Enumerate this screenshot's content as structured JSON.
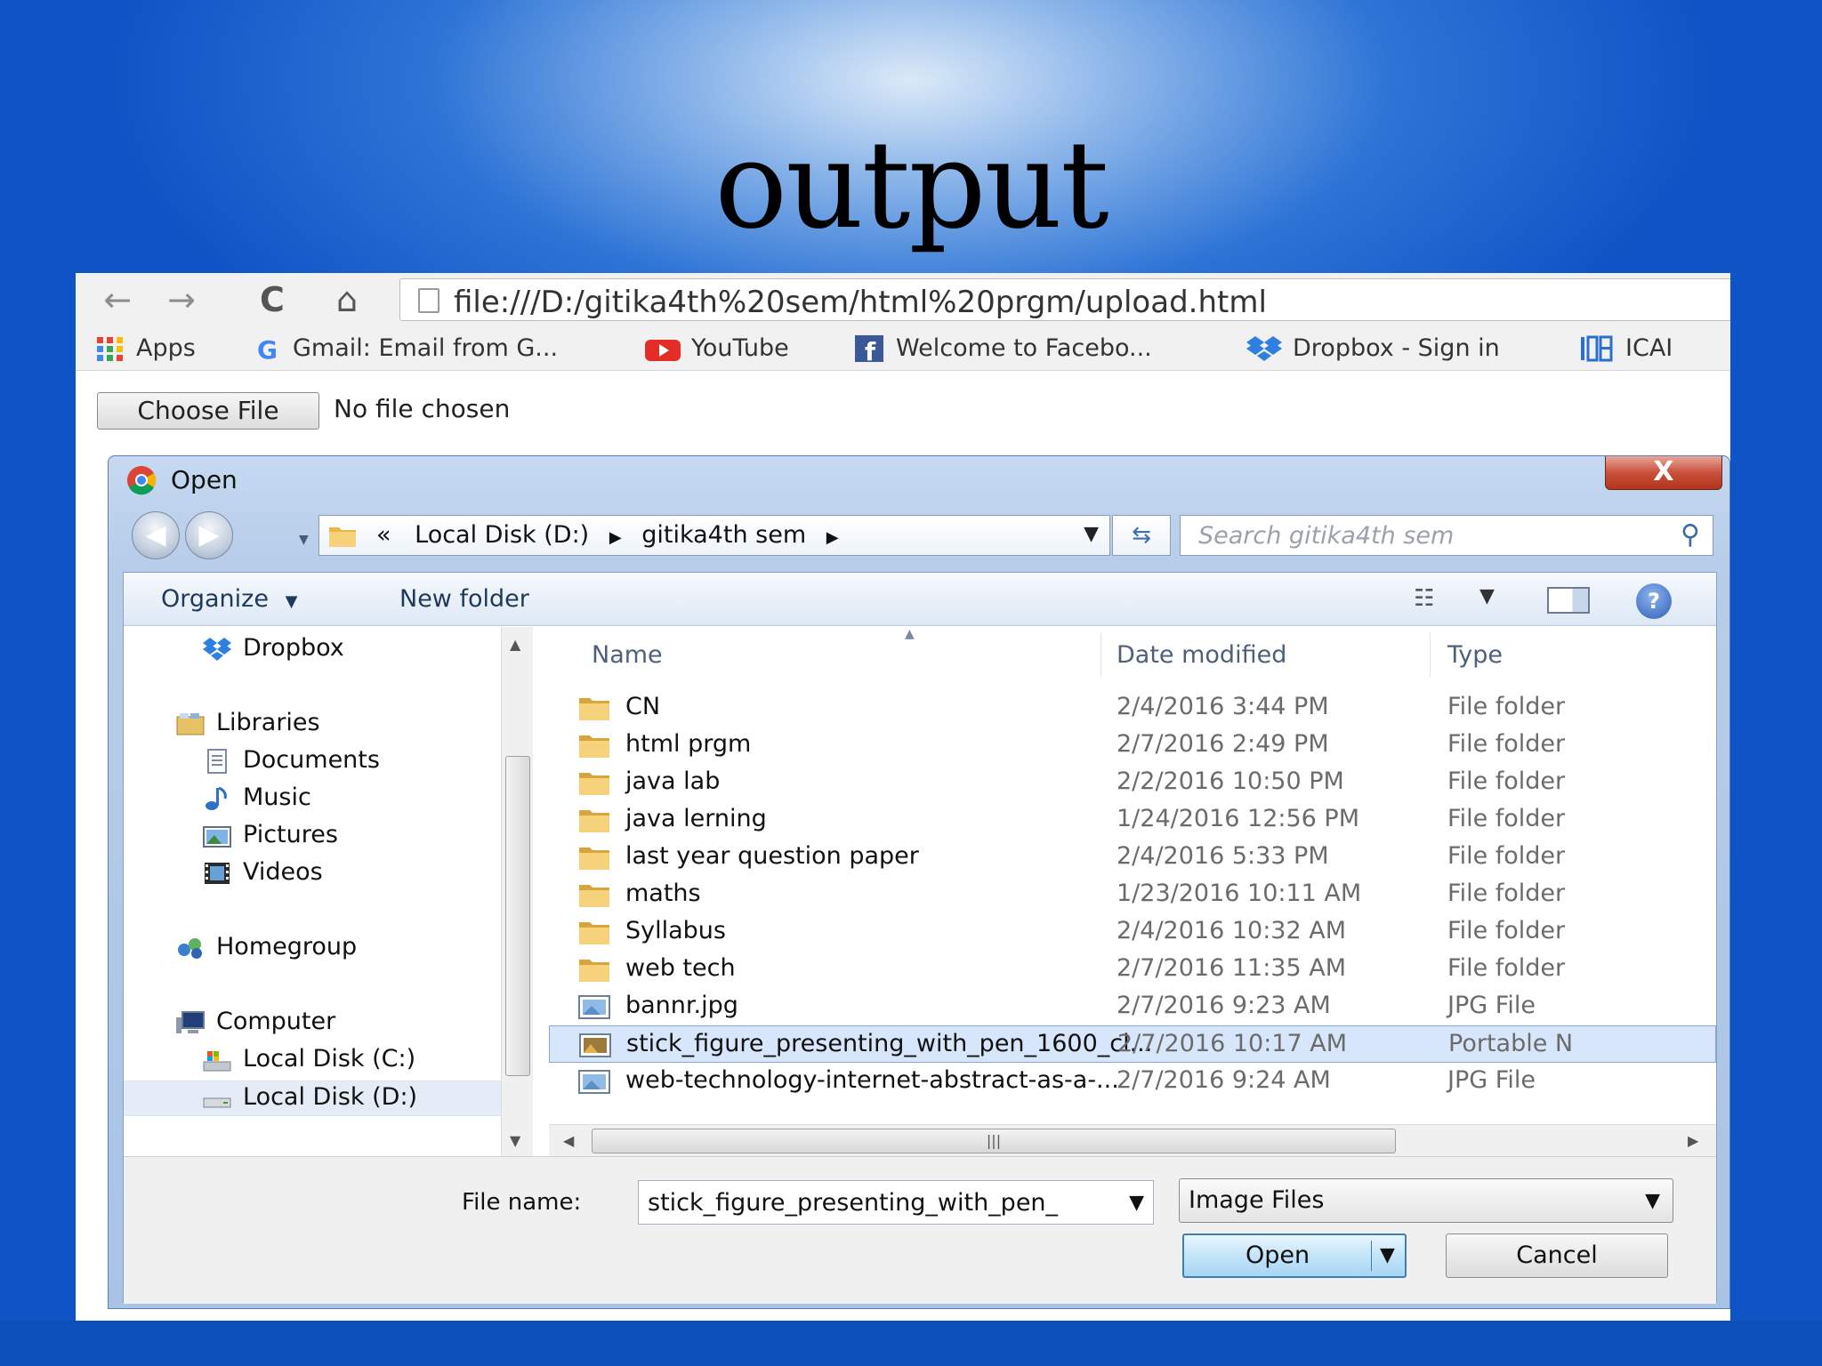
{
  "slide": {
    "title": "output"
  },
  "browser": {
    "nav": {
      "back": "←",
      "forward": "→",
      "reload": "C",
      "home": "⌂"
    },
    "url": "file:///D:/gitika4th%20sem/html%20prgm/upload.html",
    "bookmarks": [
      {
        "label": "Apps",
        "icon": "apps-grid-icon"
      },
      {
        "label": "Gmail: Email from G...",
        "icon": "google-icon"
      },
      {
        "label": "YouTube",
        "icon": "youtube-icon"
      },
      {
        "label": "Welcome to Facebo...",
        "icon": "facebook-icon"
      },
      {
        "label": "Dropbox - Sign in",
        "icon": "dropbox-icon"
      },
      {
        "label": "ICAI",
        "icon": "icai-icon"
      }
    ]
  },
  "page": {
    "choose_file_label": "Choose File",
    "no_file_text": "No file chosen"
  },
  "dialog": {
    "title": "Open",
    "close_label": "X",
    "address": {
      "prefix": "«",
      "crumbs": [
        "Local Disk (D:)",
        "gitika4th sem"
      ]
    },
    "search_placeholder": "Search gitika4th sem",
    "toolbar": {
      "organize": "Organize",
      "new_folder": "New folder"
    },
    "nav_pane": [
      {
        "label": "Dropbox",
        "icon": "dropbox-icon",
        "level": 1
      },
      {
        "label": "Libraries",
        "icon": "libraries-icon",
        "level": 0
      },
      {
        "label": "Documents",
        "icon": "documents-icon",
        "level": 1
      },
      {
        "label": "Music",
        "icon": "music-icon",
        "level": 1
      },
      {
        "label": "Pictures",
        "icon": "pictures-icon",
        "level": 1
      },
      {
        "label": "Videos",
        "icon": "videos-icon",
        "level": 1
      },
      {
        "label": "Homegroup",
        "icon": "homegroup-icon",
        "level": 0
      },
      {
        "label": "Computer",
        "icon": "computer-icon",
        "level": 0
      },
      {
        "label": "Local Disk (C:)",
        "icon": "drive-c-icon",
        "level": 1
      },
      {
        "label": "Local Disk (D:)",
        "icon": "drive-d-icon",
        "level": 1,
        "selected": true
      }
    ],
    "columns": {
      "name": "Name",
      "date": "Date modified",
      "type": "Type"
    },
    "files": [
      {
        "name": "CN",
        "date": "2/4/2016 3:44 PM",
        "type": "File folder",
        "icon": "folder-icon"
      },
      {
        "name": "html prgm",
        "date": "2/7/2016 2:49 PM",
        "type": "File folder",
        "icon": "folder-icon"
      },
      {
        "name": "java lab",
        "date": "2/2/2016 10:50 PM",
        "type": "File folder",
        "icon": "folder-icon"
      },
      {
        "name": "java lerning",
        "date": "1/24/2016 12:56 PM",
        "type": "File folder",
        "icon": "folder-icon"
      },
      {
        "name": "last year question paper",
        "date": "2/4/2016 5:33 PM",
        "type": "File folder",
        "icon": "folder-icon"
      },
      {
        "name": "maths",
        "date": "1/23/2016 10:11 AM",
        "type": "File folder",
        "icon": "folder-icon"
      },
      {
        "name": "Syllabus",
        "date": "2/4/2016 10:32 AM",
        "type": "File folder",
        "icon": "folder-icon"
      },
      {
        "name": "web tech",
        "date": "2/7/2016 11:35 AM",
        "type": "File folder",
        "icon": "folder-icon"
      },
      {
        "name": "bannr.jpg",
        "date": "2/7/2016 9:23 AM",
        "type": "JPG File",
        "icon": "image-file-icon"
      },
      {
        "name": "stick_figure_presenting_with_pen_1600_cl...",
        "date": "2/7/2016 10:17 AM",
        "type": "Portable N",
        "icon": "png-file-icon",
        "selected": true
      },
      {
        "name": "web-technology-internet-abstract-as-a-...",
        "date": "2/7/2016 9:24 AM",
        "type": "JPG File",
        "icon": "image-file-icon"
      }
    ],
    "file_name_label": "File name:",
    "file_name_value": "stick_figure_presenting_with_pen_",
    "file_type_value": "Image Files",
    "open_label": "Open",
    "cancel_label": "Cancel"
  },
  "colors": {
    "slide_bg": "#1a5fcf",
    "selection": "#d7e6fa",
    "dialog_chrome": "#b7cde9",
    "close_red": "#c8513c"
  }
}
